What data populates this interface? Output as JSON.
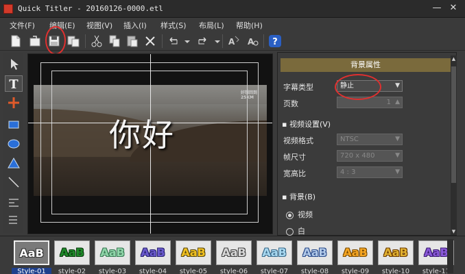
{
  "window": {
    "title": "Quick Titler - 20160126-0000.etl",
    "minimize": "—",
    "close": "✕"
  },
  "menu": [
    "文件(F)",
    "编辑(E)",
    "视图(V)",
    "插入(I)",
    "样式(S)",
    "布局(L)",
    "帮助(H)"
  ],
  "toolbar": {
    "icons": [
      "new-file-icon",
      "open-file-icon",
      "save-icon",
      "save-as-icon",
      "cut-icon",
      "copy-icon",
      "paste-icon",
      "delete-icon",
      "undo-icon",
      "redo-icon",
      "text-style-icon",
      "text-search-icon",
      "help-icon"
    ],
    "help": "?"
  },
  "tools": [
    "select-arrow-icon",
    "text-tool-icon",
    "move-tool-icon",
    "rectangle-icon",
    "ellipse-icon",
    "triangle-icon",
    "line-icon",
    "align-icon",
    "distribute-icon"
  ],
  "canvas": {
    "caption": "你好",
    "logo_mark": "好想回到\n25KM"
  },
  "panel": {
    "header": "背景属性",
    "caption_type_label": "字幕类型",
    "caption_type_value": "静止",
    "page_label": "页数",
    "page_value": "1",
    "video_section": "视频设置(V)",
    "video_format_label": "视频格式",
    "video_format_value": "NTSC",
    "frame_size_label": "帧尺寸",
    "frame_size_value": "720 x 480",
    "aspect_label": "宽高比",
    "aspect_value": "4 : 3",
    "bg_section": "背景(B)",
    "bg_video": "视频",
    "bg_white": "白"
  },
  "styles": [
    {
      "label": "Style-01",
      "text": "AaB",
      "color": "#ffffff",
      "stroke": "#333333",
      "bg": "#6a6a6a"
    },
    {
      "label": "style-02",
      "text": "AaB",
      "color": "#1f8a2a",
      "stroke": "#0c3b10",
      "bg": "#e6e6e6"
    },
    {
      "label": "style-03",
      "text": "AaB",
      "color": "#8fd4a8",
      "stroke": "#3a7a55",
      "bg": "#e6e6e6"
    },
    {
      "label": "style-04",
      "text": "AaB",
      "color": "#6a5acd",
      "stroke": "#2a2470",
      "bg": "#e6e6e6"
    },
    {
      "label": "style-05",
      "text": "AaB",
      "color": "#f0c020",
      "stroke": "#5a4a10",
      "bg": "#e6e6e6"
    },
    {
      "label": "style-06",
      "text": "AaB",
      "color": "#d7d7d7",
      "stroke": "#444444",
      "bg": "#e6e6e6"
    },
    {
      "label": "style-07",
      "text": "AaB",
      "color": "#a8d8f0",
      "stroke": "#3a6a8a",
      "bg": "#e6e6e6"
    },
    {
      "label": "style-08",
      "text": "AaB",
      "color": "#b0c8e8",
      "stroke": "#2a4a8a",
      "bg": "#e6e6e6"
    },
    {
      "label": "style-09",
      "text": "AaB",
      "color": "#f5a623",
      "stroke": "#7a4a00",
      "bg": "#e6e6e6"
    },
    {
      "label": "style-10",
      "text": "AaB",
      "color": "#e0b030",
      "stroke": "#6a3a00",
      "bg": "#e6e6e6"
    },
    {
      "label": "style-11",
      "text": "AaB",
      "color": "#8a5ad8",
      "stroke": "#3a1a70",
      "bg": "#e6e6e6"
    }
  ],
  "colors": {
    "accent_header": "#7a6a3c",
    "selection": "#1d3f8c",
    "annotation": "#e0302f"
  }
}
